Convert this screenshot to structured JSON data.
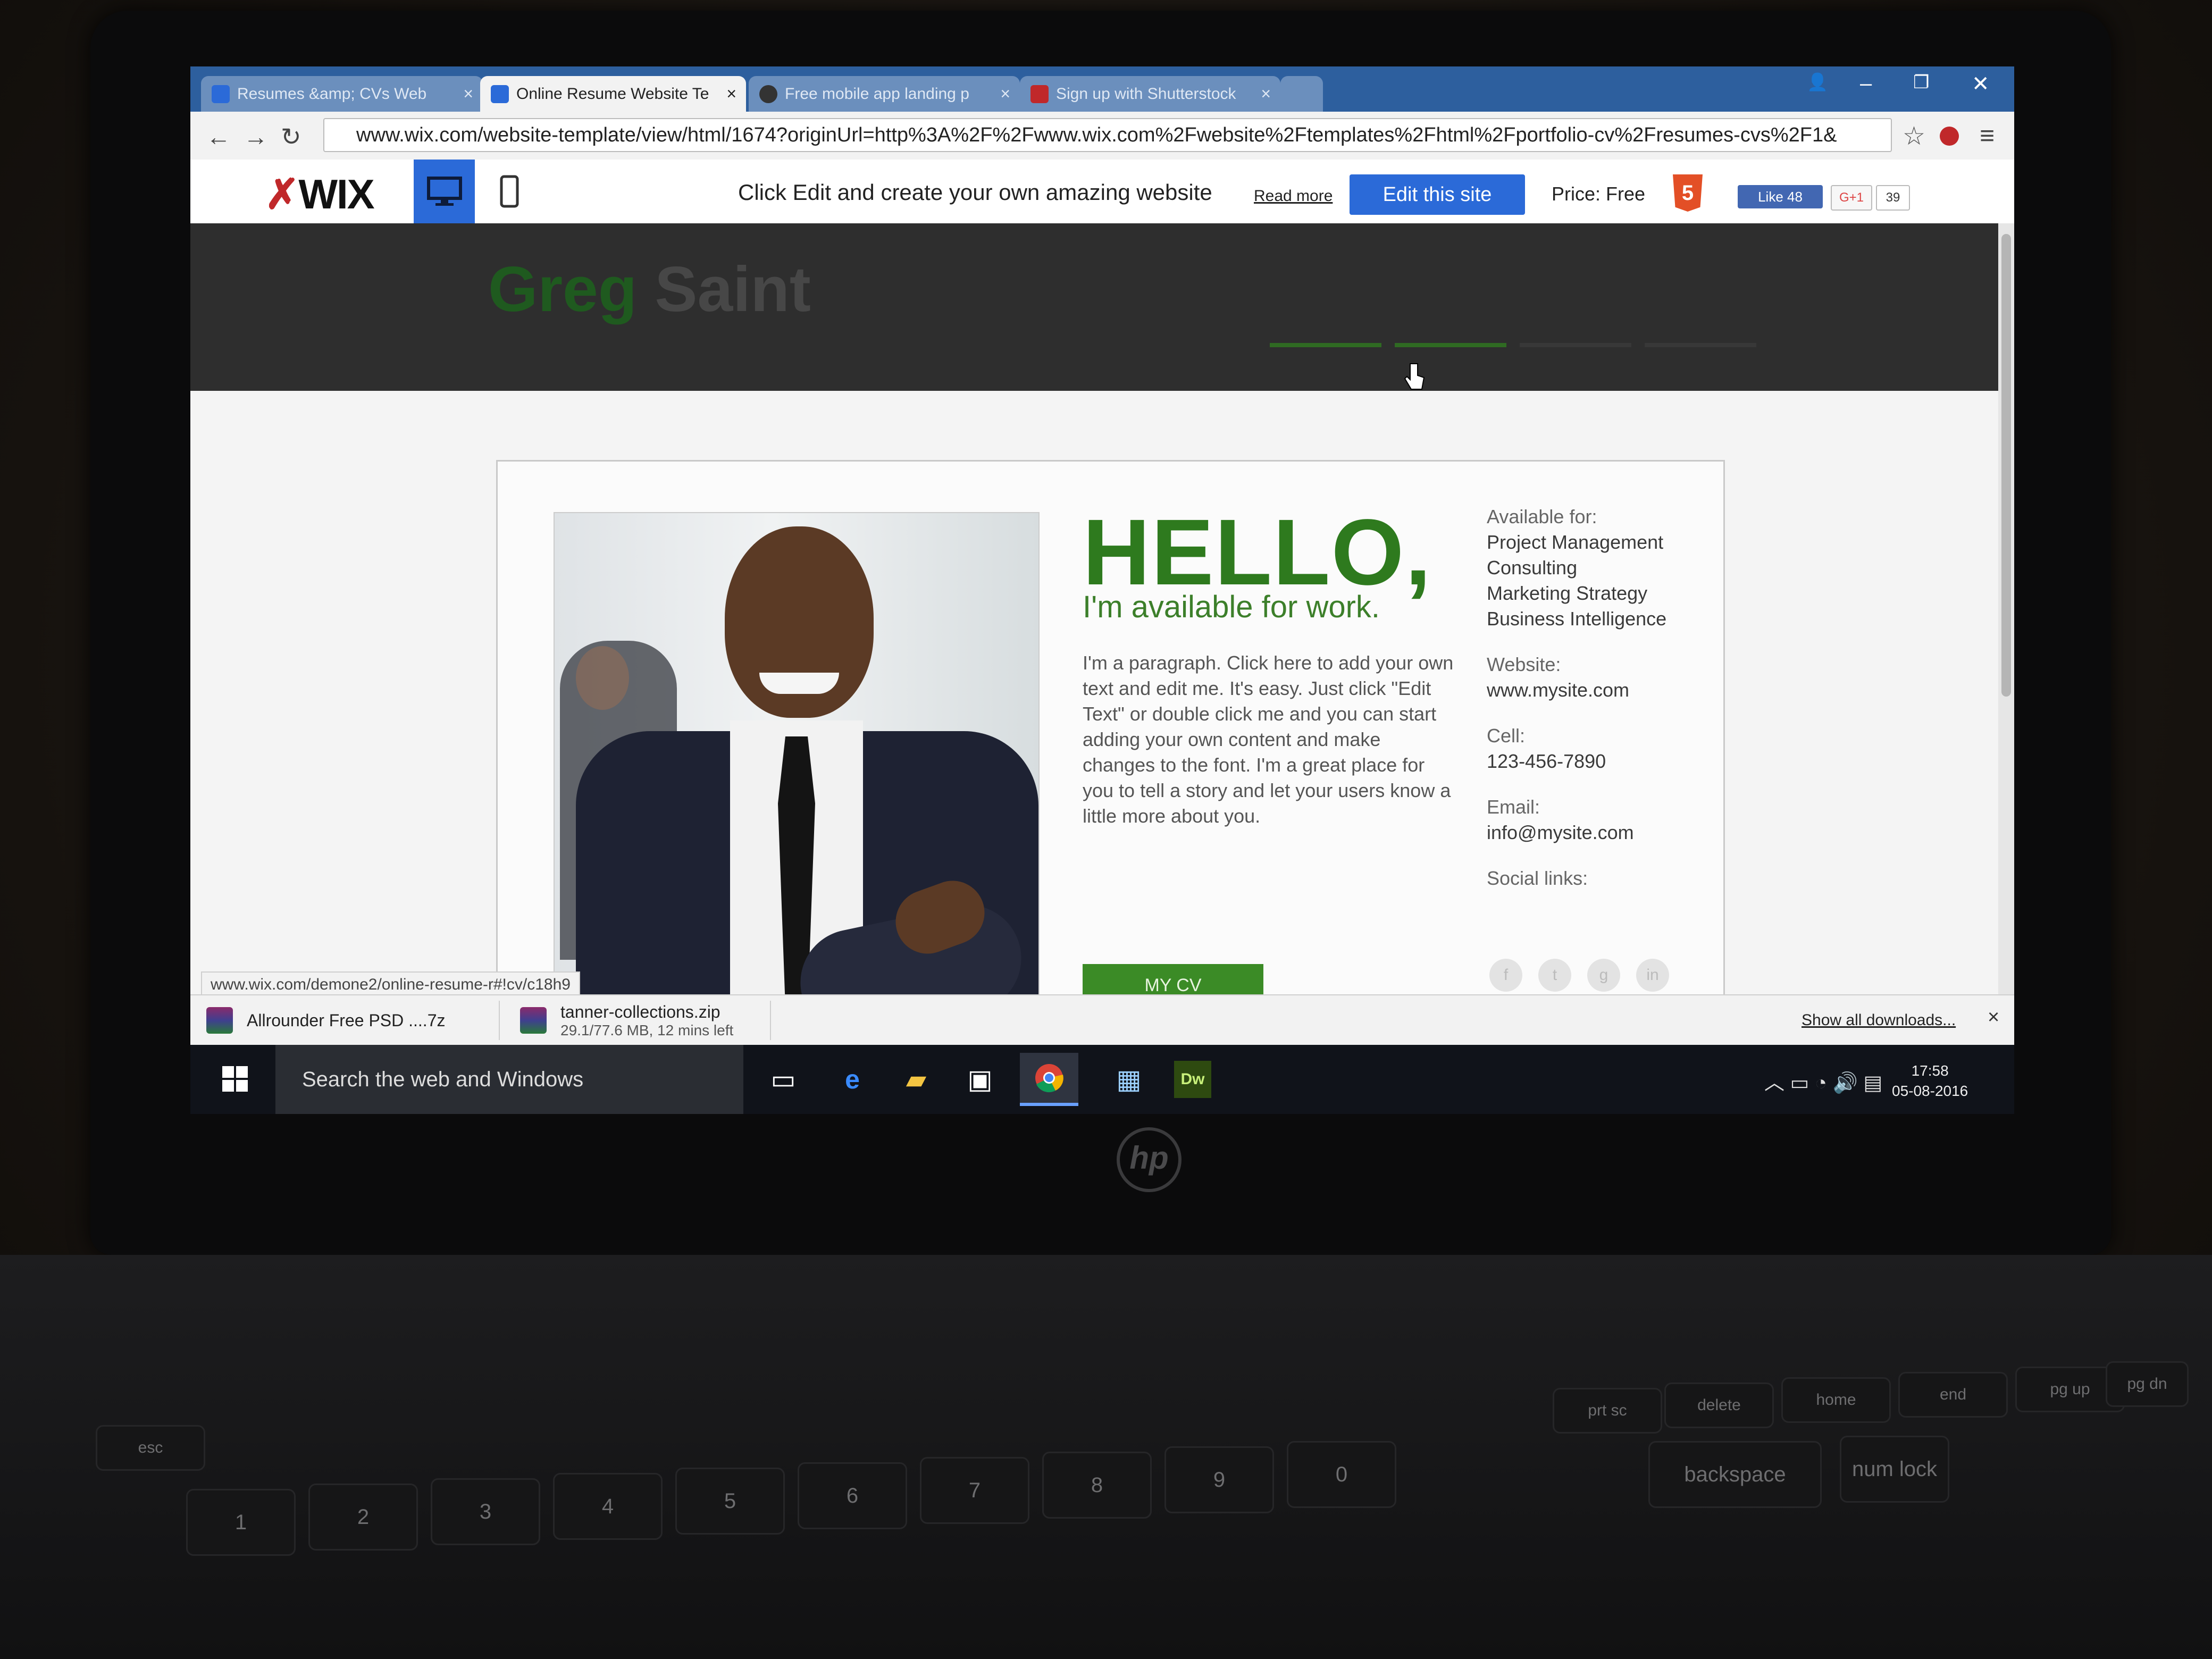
{
  "browser": {
    "tabs": [
      {
        "label": "Resumes &amp; CVs Web",
        "color": "#2b6ad8"
      },
      {
        "label": "Online Resume Website Te",
        "color": "#2b6ad8"
      },
      {
        "label": "Free mobile app landing p",
        "color": "#333333"
      },
      {
        "label": "Sign up with Shutterstock",
        "color": "#c0282a"
      }
    ],
    "url": "www.wix.com/website-template/view/html/1674?originUrl=http%3A%2F%2Fwww.wix.com%2Fwebsite%2Ftemplates%2Fhtml%2Fportfolio-cv%2Fresumes-cvs%2F1&"
  },
  "wixbar": {
    "logo": "WIX",
    "promo": "Click Edit and create your own amazing website",
    "read_more": "Read more",
    "edit_button": "Edit this site",
    "price": "Price: Free",
    "fb_like": "Like 48",
    "gplus": "G+1",
    "gplus_count": "39"
  },
  "site": {
    "name_first": "Greg",
    "name_last": "Saint"
  },
  "hero": {
    "hello": "HELLO,",
    "subtitle": "I'm available for work.",
    "paragraph": "I'm a paragraph. Click here to add your own text and edit me. It's easy. Just click \"Edit Text\" or double click me and you can start adding your own content and make changes to the font. I'm a great place for you to tell a story and let your users know a little more about you.",
    "cv_button": "MY CV"
  },
  "sidebar": {
    "available_label": "Available for:",
    "available_items": [
      "Project Management",
      "Consulting",
      "Marketing Strategy",
      "Business Intelligence"
    ],
    "website_label": "Website:",
    "website": "www.mysite.com",
    "cell_label": "Cell:",
    "cell": "123-456-7890",
    "email_label": "Email:",
    "email": "info@mysite.com",
    "social_label": "Social links:"
  },
  "status": {
    "hover_url": "www.wix.com/demone2/online-resume-r#!cv/c18h9"
  },
  "downloads": {
    "items": [
      {
        "name": "Allrounder Free PSD ....7z",
        "progress": ""
      },
      {
        "name": "tanner-collections.zip",
        "progress": "29.1/77.6 MB, 12 mins left"
      }
    ],
    "show_all": "Show all downloads..."
  },
  "taskbar": {
    "search_placeholder": "Search the web and Windows",
    "time": "17:58",
    "date": "05-08-2016"
  },
  "keyboard": {
    "fkeys": [
      "esc",
      "delete",
      "home",
      "end",
      "pg up",
      "pg dn"
    ],
    "numkeys": [
      "1",
      "2",
      "3",
      "4",
      "5",
      "6",
      "7",
      "8",
      "9",
      "0"
    ],
    "other": [
      "backspace",
      "num lock",
      "prt sc"
    ]
  },
  "laptop": {
    "brand": "hp"
  },
  "colors": {
    "accent_green": "#2e7a1e",
    "wix_blue": "#2b6ad8",
    "header_dark": "#2e2e2e"
  }
}
